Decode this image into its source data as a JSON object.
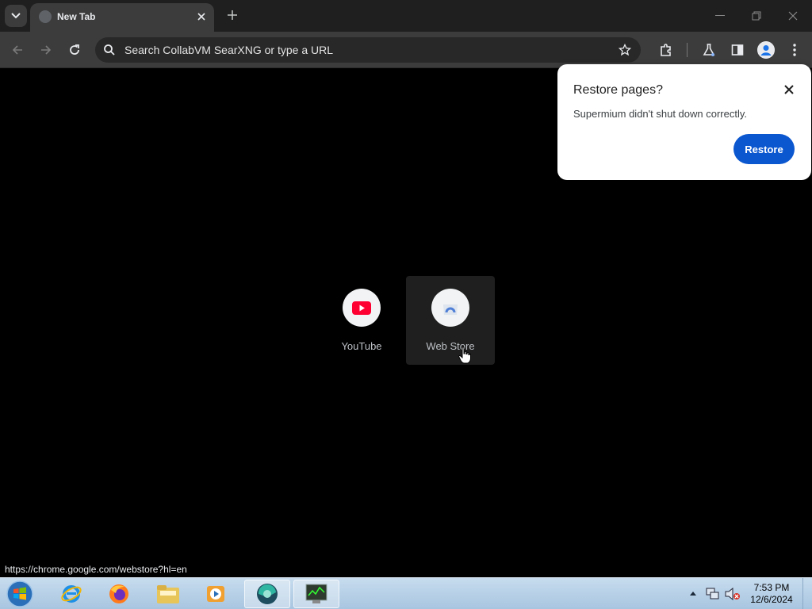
{
  "browser": {
    "tab": {
      "title": "New Tab"
    },
    "omnibox": {
      "placeholder": "Search CollabVM SearXNG or type a URL"
    }
  },
  "restore_popup": {
    "title": "Restore pages?",
    "message": "Supermium didn't shut down correctly.",
    "restore_label": "Restore"
  },
  "shortcuts": [
    {
      "label": "YouTube",
      "icon": "youtube-icon"
    },
    {
      "label": "Web Store",
      "icon": "web-store-icon"
    }
  ],
  "status_bar": {
    "url": "https://chrome.google.com/webstore?hl=en"
  },
  "taskbar": {
    "items": [
      "internet-explorer-icon",
      "firefox-icon",
      "file-explorer-icon",
      "media-player-icon",
      "supermium-icon",
      "task-manager-icon"
    ],
    "clock": {
      "time": "7:53 PM",
      "date": "12/6/2024"
    }
  },
  "colors": {
    "accent": "#0b57d0",
    "tab_bg": "#3c3c3c",
    "toolbar_bg": "#3c3c3c",
    "page_bg": "#000000"
  }
}
